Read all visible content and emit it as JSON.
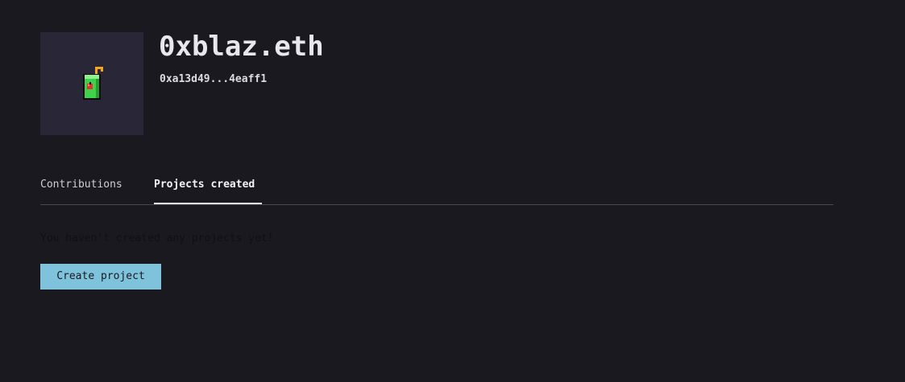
{
  "profile": {
    "name": "0xblaz.eth",
    "address": "0xa13d49...4eaff1",
    "avatar_icon": "juice-box-icon"
  },
  "tabs": [
    {
      "label": "Contributions",
      "active": false
    },
    {
      "label": "Projects created",
      "active": true
    }
  ],
  "projects": {
    "empty_message": "You haven't created any projects yet!",
    "create_label": "Create project"
  },
  "colors": {
    "background": "#1a191f",
    "avatar_bg": "#292637",
    "button_bg": "#7ec3db",
    "juice_box_green": "#3fd14a",
    "straw_orange": "#f5a623",
    "apple_red": "#e0342f"
  }
}
